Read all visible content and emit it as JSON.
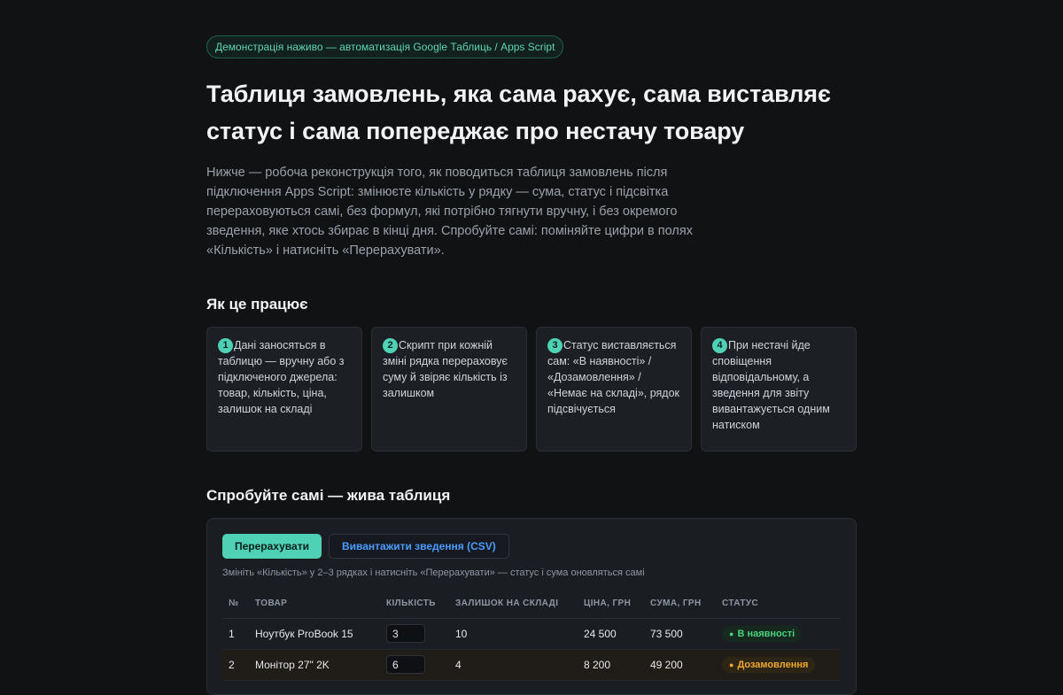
{
  "header": {
    "pill": "Демонстрація наживо — автоматизація Google Таблиць / Apps Script",
    "title_line1": "Таблиця замовлень, яка сама рахує, сама виставляє",
    "title_line2": "статус і сама попереджає про нестачу товару",
    "lead": "Нижче — робоча реконструкція того, як поводиться таблиця замовлень після підключення Apps Script: змінюєте кількість у рядку — сума, статус і підсвітка перераховуються самі, без формул, які потрібно тягнути вручну, і без окремого зведення, яке хтось збирає в кінці дня. Спробуйте самі: поміняйте цифри в полях «Кількість» і натисніть «Перерахувати»."
  },
  "how": {
    "title": "Як це працює",
    "steps": [
      {
        "num": "1",
        "text": "Дані заносяться в таблицю — вручну або з підключеного джерела: товар, кількість, ціна, залишок на складі"
      },
      {
        "num": "2",
        "text": "Скрипт при кожній зміні рядка перераховує суму й звіряє кількість із залишком"
      },
      {
        "num": "3",
        "text": "Статус виставляється сам: «В наявності» / «Дозамовлення» / «Немає на складі», рядок підсвічується"
      },
      {
        "num": "4",
        "text": "При нестачі йде сповіщення відповідальному, а зведення для звіту вивантажується одним натиском"
      }
    ]
  },
  "demo": {
    "title": "Спробуйте самі — жива таблиця",
    "recalc_label": "Перерахувати",
    "export_label": "Вивантажити зведення (CSV)",
    "hint": "Змініть «Кількість» у 2–3 рядках і натисніть «Перерахувати» — статус і сума оновляться самі",
    "columns": [
      "№",
      "ТОВАР",
      "КІЛЬКІСТЬ",
      "ЗАЛИШОК НА СКЛАДІ",
      "ЦІНА, ГРН",
      "СУМА, ГРН",
      "СТАТУС"
    ],
    "rows": [
      {
        "n": "1",
        "product": "Ноутбук ProBook 15",
        "qty": "3",
        "stock": "10",
        "price": "24 500",
        "sum": "73 500",
        "status": "В наявності",
        "status_kind": "ok"
      },
      {
        "n": "2",
        "product": "Монітор 27\" 2K",
        "qty": "6",
        "stock": "4",
        "price": "8 200",
        "sum": "49 200",
        "status": "Дозамовлення",
        "status_kind": "reorder"
      }
    ]
  },
  "colors": {
    "accent": "#4fd1b5",
    "link": "#4a9cff",
    "ok": "#49d17d",
    "reorder": "#f0a830"
  }
}
